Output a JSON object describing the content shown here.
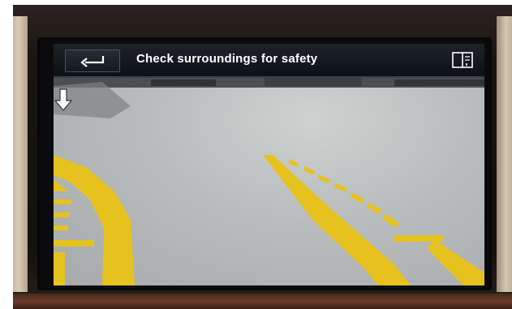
{
  "header": {
    "title": "Check surroundings for safety",
    "back_icon": "back-arrow-icon",
    "manual_icon": "manual-book-icon"
  },
  "camera": {
    "guide_line_color": "#e6c21f",
    "indicator_icon": "down-arrow-icon"
  },
  "colors": {
    "header_bg": "#12171b",
    "title_text": "#ffffff",
    "guide_lines": "#e6c21f"
  }
}
